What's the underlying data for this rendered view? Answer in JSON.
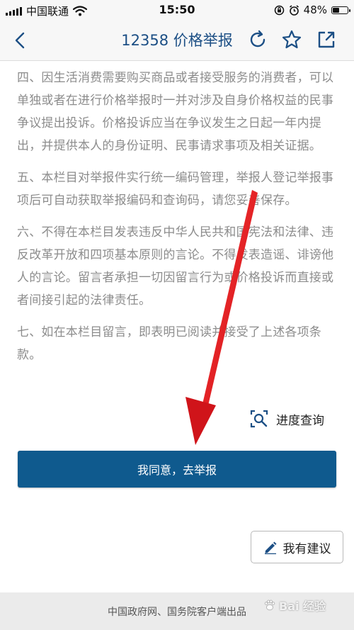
{
  "status_bar": {
    "carrier": "中国联通",
    "time": "15:50",
    "battery_text": "48%",
    "battery_level": 0.48,
    "icons": [
      "signal-icon",
      "wifi-icon",
      "orientation-lock-icon",
      "alarm-icon",
      "battery-icon"
    ]
  },
  "nav": {
    "title": "12358 价格举报",
    "icons": [
      "back-icon",
      "refresh-icon",
      "star-icon",
      "share-icon"
    ],
    "accent_color": "#1c4f85"
  },
  "terms": [
    "四、因生活消费需要购买商品或者接受服务的消费者，可以单独或者在进行价格举报时一并对涉及自身价格权益的民事争议提出投诉。价格投诉应当在争议发生之日起一年内提出，并提供本人的身份证明、民事请求事项及相关证据。",
    "五、本栏目对举报件实行统一编码管理，举报人登记举报事项后可自动获取举报编码和查询码，请您妥善保存。",
    "六、不得在本栏目发表违反中华人民共和国宪法和法律、违反改革开放和四项基本原则的言论。不得发表造谣、诽谤他人的言论。留言者承担一切因留言行为或价格投诉而直接或者间接引起的法律责任。",
    "七、如在本栏目留言，即表明已阅读并接受了上述各项条款。"
  ],
  "progress_query": {
    "label": "进度查询",
    "icon": "search-document-icon"
  },
  "agree_button": {
    "label": "我同意，去举报",
    "color": "#0f5a8e"
  },
  "suggest_button": {
    "label": "我有建议",
    "icon": "pencil-icon"
  },
  "footer": {
    "text": "中国政府网、国务院客户端出品"
  },
  "watermark": {
    "text": "Bai 经验"
  },
  "annotation": {
    "color": "#e3141c",
    "type": "red-arrow"
  }
}
